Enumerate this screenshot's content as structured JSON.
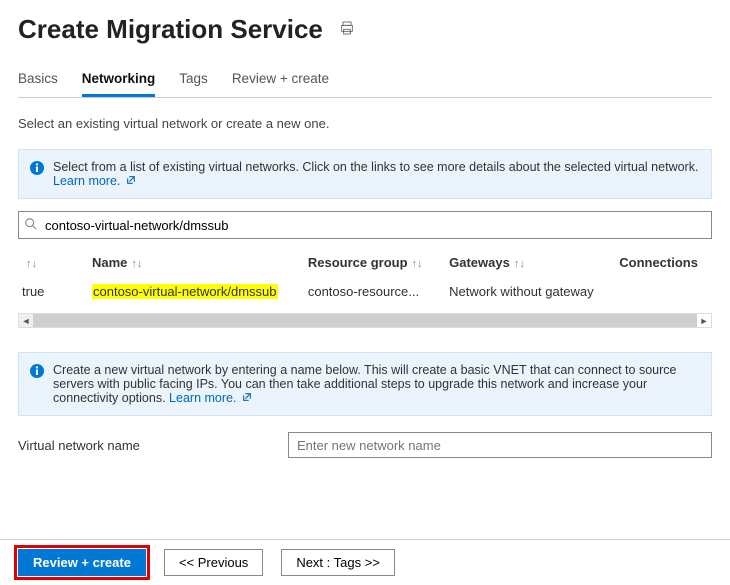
{
  "header": {
    "title": "Create Migration Service"
  },
  "tabs": [
    "Basics",
    "Networking",
    "Tags",
    "Review + create"
  ],
  "active_tab": "Networking",
  "description": "Select an existing virtual network or create a new one.",
  "info_select": {
    "text": "Select from a list of existing virtual networks. Click on the links to see more details about the selected virtual network.",
    "learn_more": "Learn more."
  },
  "search": {
    "value": "contoso-virtual-network/dmssub"
  },
  "table": {
    "columns": [
      "",
      "Name",
      "Resource group",
      "Gateways",
      "Connections"
    ],
    "rows": [
      {
        "sel": "true",
        "name": "contoso-virtual-network/dmssub",
        "rg": "contoso-resource...",
        "gateway": "Network without gateway"
      }
    ]
  },
  "info_create": {
    "text": "Create a new virtual network by entering a name below. This will create a basic VNET that can connect to source servers with public facing IPs. You can then take additional steps to upgrade this network and increase your connectivity options.",
    "learn_more": "Learn more."
  },
  "vnet_field": {
    "label": "Virtual network name",
    "placeholder": "Enter new network name"
  },
  "footer": {
    "primary": "Review + create",
    "previous": "<<  Previous",
    "next": "Next : Tags >>"
  }
}
